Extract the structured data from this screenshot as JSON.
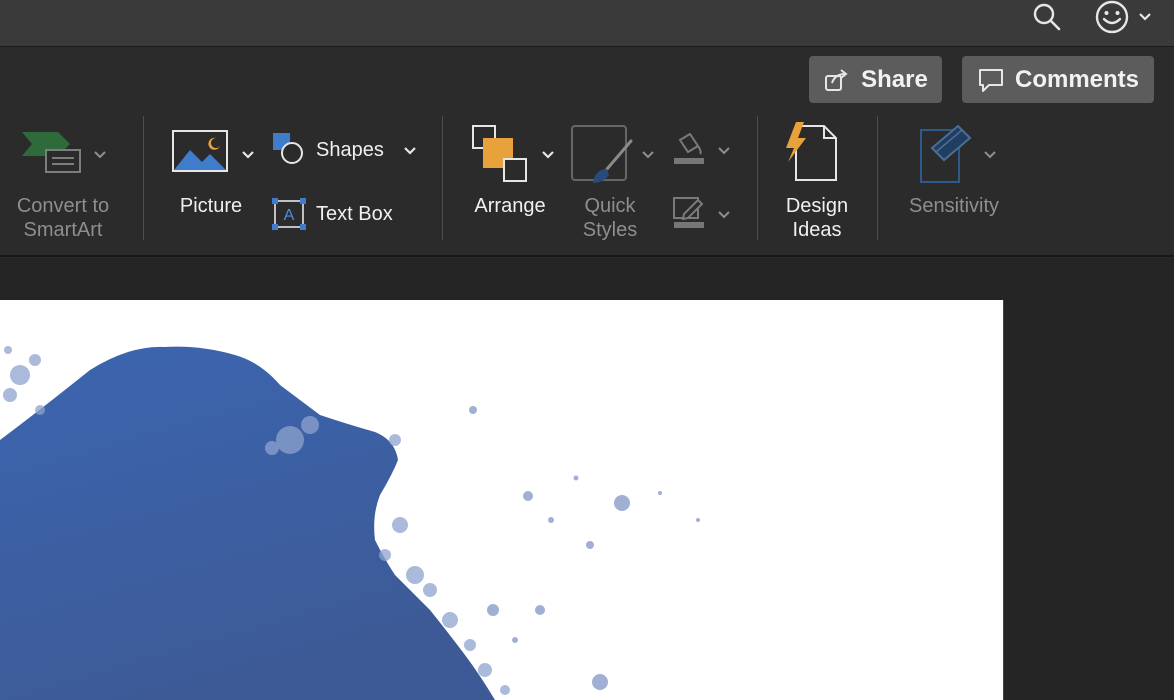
{
  "titlebar": {
    "search_icon": "search-icon",
    "feedback_icon": "smiley-icon"
  },
  "ribbon": {
    "share_label": "Share",
    "comments_label": "Comments",
    "convert_smartart": {
      "line1": "Convert to",
      "line2": "SmartArt"
    },
    "picture_label": "Picture",
    "shapes_label": "Shapes",
    "textbox_label": "Text Box",
    "arrange_label": "Arrange",
    "quick_styles": {
      "line1": "Quick",
      "line2": "Styles"
    },
    "design_ideas": {
      "line1": "Design",
      "line2": "Ideas"
    },
    "sensitivity_label": "Sensitivity"
  },
  "colors": {
    "ribbon_bg": "#2b2b2b",
    "titlebar_bg": "#3a3a3a",
    "button_bg": "#5c5c5c",
    "accent_blue": "#3f66b0",
    "accent_orange": "#e8a23c",
    "slide_bg": "#ffffff"
  }
}
